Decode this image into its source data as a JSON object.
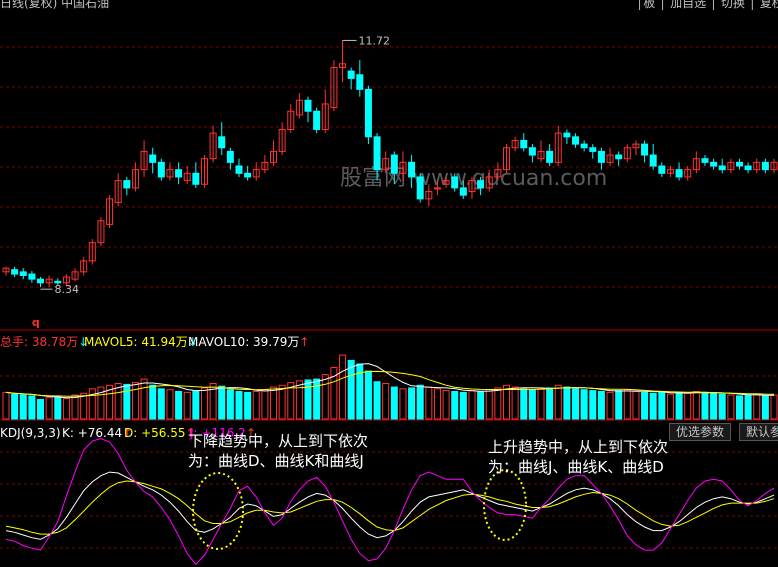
{
  "top_bar": {
    "left_text": "日线(复权) 中国石油",
    "right_text": "│板 │ 加自选 │ 切换 │ 复权 │"
  },
  "price_panel": {
    "high_label": "11.72",
    "low_label": "8.34",
    "marker": "q"
  },
  "watermark": "股富网 www.gucuan.com",
  "volume_header": {
    "total": "总手: 38.78万",
    "mavol5": "MAVOL5: 41.94万",
    "mavol10": "MAVOL10: 39.79万"
  },
  "kdj_header": {
    "name": "KDJ(9,3,3)",
    "k": "K: +76.44",
    "d": "D: +56.55",
    "j": "J: +116.2"
  },
  "buttons": {
    "optimize": "优选参数",
    "default": "默认参"
  },
  "annotations": {
    "down_line1": "下降趋势中，从上到下依次",
    "down_line2": "为：曲线D、曲线K和曲线J",
    "up_line1": "上升趋势中，从上到下依次",
    "up_line2": "为：曲线J、曲线K、曲线D"
  },
  "colors": {
    "up": "#ff3232",
    "down": "#00ffff",
    "grid": "#800000",
    "k_line": "#ffffff",
    "d_line": "#ffff00",
    "j_line": "#ff00ff",
    "mavol5": "#ffffff",
    "mavol10": "#ffff00",
    "ellipse": "#ffff00"
  },
  "chart_data": [
    {
      "type": "candlestick",
      "y_range": [
        8.0,
        12.0
      ],
      "candles": [
        [
          8.55,
          8.6,
          8.5,
          8.62
        ],
        [
          8.58,
          8.52,
          8.48,
          8.62
        ],
        [
          8.55,
          8.5,
          8.45,
          8.6
        ],
        [
          8.52,
          8.45,
          8.4,
          8.56
        ],
        [
          8.45,
          8.4,
          8.34,
          8.48
        ],
        [
          8.4,
          8.45,
          8.34,
          8.5
        ],
        [
          8.42,
          8.4,
          8.36,
          8.46
        ],
        [
          8.4,
          8.48,
          8.36,
          8.52
        ],
        [
          8.45,
          8.55,
          8.42,
          8.6
        ],
        [
          8.55,
          8.7,
          8.5,
          8.75
        ],
        [
          8.7,
          8.95,
          8.65,
          9.0
        ],
        [
          8.95,
          9.25,
          8.9,
          9.3
        ],
        [
          9.2,
          9.55,
          9.15,
          9.6
        ],
        [
          9.5,
          9.8,
          9.45,
          9.9
        ],
        [
          9.8,
          9.7,
          9.6,
          9.85
        ],
        [
          9.7,
          9.95,
          9.65,
          10.05
        ],
        [
          9.95,
          10.2,
          9.85,
          10.35
        ],
        [
          10.15,
          10.05,
          9.9,
          10.25
        ],
        [
          10.05,
          9.85,
          9.8,
          10.1
        ],
        [
          9.85,
          9.95,
          9.8,
          10.05
        ],
        [
          9.95,
          9.85,
          9.75,
          10.05
        ],
        [
          9.8,
          9.9,
          9.75,
          10.0
        ],
        [
          9.9,
          9.75,
          9.7,
          10.05
        ],
        [
          9.75,
          10.1,
          9.7,
          10.15
        ],
        [
          10.1,
          10.45,
          10.05,
          10.55
        ],
        [
          10.4,
          10.25,
          10.15,
          10.6
        ],
        [
          10.2,
          10.05,
          9.95,
          10.25
        ],
        [
          10.0,
          9.9,
          9.85,
          10.1
        ],
        [
          9.9,
          9.85,
          9.8,
          10.0
        ],
        [
          9.85,
          9.95,
          9.8,
          10.05
        ],
        [
          9.95,
          10.05,
          9.9,
          10.15
        ],
        [
          10.05,
          10.2,
          10.0,
          10.35
        ],
        [
          10.2,
          10.5,
          10.15,
          10.6
        ],
        [
          10.5,
          10.75,
          10.45,
          10.85
        ],
        [
          10.7,
          10.9,
          10.65,
          11.0
        ],
        [
          10.9,
          10.75,
          10.6,
          10.95
        ],
        [
          10.75,
          10.5,
          10.45,
          10.8
        ],
        [
          10.5,
          10.85,
          10.45,
          11.05
        ],
        [
          10.8,
          11.35,
          10.75,
          11.45
        ],
        [
          11.35,
          11.4,
          11.15,
          11.72
        ],
        [
          11.3,
          11.2,
          11.05,
          11.35
        ],
        [
          11.25,
          11.05,
          10.95,
          11.45
        ],
        [
          11.05,
          10.4,
          10.3,
          11.1
        ],
        [
          10.4,
          9.95,
          9.8,
          10.45
        ],
        [
          9.95,
          10.1,
          9.9,
          10.2
        ],
        [
          10.15,
          9.9,
          9.75,
          10.2
        ],
        [
          9.9,
          10.05,
          9.8,
          10.2
        ],
        [
          10.05,
          9.85,
          9.7,
          10.15
        ],
        [
          9.85,
          9.55,
          9.5,
          9.9
        ],
        [
          9.55,
          9.65,
          9.45,
          9.75
        ],
        [
          9.7,
          9.7,
          9.6,
          9.8
        ],
        [
          9.75,
          9.8,
          9.7,
          9.85
        ],
        [
          9.85,
          9.7,
          9.65,
          9.9
        ],
        [
          9.7,
          9.6,
          9.55,
          9.8
        ],
        [
          9.65,
          9.8,
          9.55,
          9.85
        ],
        [
          9.8,
          9.7,
          9.6,
          9.85
        ],
        [
          9.7,
          9.85,
          9.65,
          9.95
        ],
        [
          9.85,
          9.95,
          9.8,
          10.05
        ],
        [
          9.95,
          10.25,
          9.9,
          10.3
        ],
        [
          10.25,
          10.35,
          10.2,
          10.4
        ],
        [
          10.35,
          10.25,
          10.2,
          10.45
        ],
        [
          10.25,
          10.15,
          10.05,
          10.3
        ],
        [
          10.1,
          10.2,
          10.05,
          10.35
        ],
        [
          10.2,
          10.05,
          10.0,
          10.3
        ],
        [
          10.05,
          10.45,
          10.0,
          10.55
        ],
        [
          10.45,
          10.4,
          10.3,
          10.5
        ],
        [
          10.4,
          10.3,
          10.25,
          10.45
        ],
        [
          10.3,
          10.25,
          10.2,
          10.35
        ],
        [
          10.25,
          10.2,
          10.1,
          10.3
        ],
        [
          10.2,
          10.05,
          9.95,
          10.25
        ],
        [
          10.05,
          10.15,
          10.0,
          10.25
        ],
        [
          10.15,
          10.1,
          10.0,
          10.2
        ],
        [
          10.1,
          10.25,
          10.05,
          10.3
        ],
        [
          10.25,
          10.3,
          10.15,
          10.35
        ],
        [
          10.3,
          10.15,
          10.05,
          10.35
        ],
        [
          10.15,
          10.0,
          9.95,
          10.3
        ],
        [
          10.0,
          9.9,
          9.85,
          10.05
        ],
        [
          9.9,
          9.95,
          9.85,
          10.0
        ],
        [
          9.95,
          9.85,
          9.8,
          10.05
        ],
        [
          9.85,
          9.95,
          9.8,
          10.0
        ],
        [
          9.95,
          10.1,
          9.9,
          10.2
        ],
        [
          10.1,
          10.05,
          10.0,
          10.15
        ],
        [
          10.05,
          10.0,
          9.95,
          10.1
        ],
        [
          10.0,
          9.95,
          9.9,
          10.1
        ],
        [
          9.95,
          10.05,
          9.9,
          10.1
        ],
        [
          10.05,
          10.0,
          9.95,
          10.1
        ],
        [
          10.0,
          9.95,
          9.9,
          10.05
        ],
        [
          9.95,
          10.05,
          9.9,
          10.1
        ],
        [
          10.05,
          9.95,
          9.9,
          10.1
        ],
        [
          9.95,
          10.05,
          9.9,
          10.1
        ]
      ]
    },
    {
      "type": "bar",
      "title": "总手",
      "values": [
        30,
        28,
        27,
        26,
        22,
        24,
        25,
        23,
        27,
        29,
        34,
        36,
        38,
        40,
        39,
        41,
        45,
        38,
        34,
        33,
        31,
        30,
        32,
        35,
        40,
        37,
        33,
        31,
        30,
        31,
        33,
        36,
        38,
        41,
        43,
        44,
        45,
        50,
        58,
        72,
        66,
        62,
        54,
        42,
        40,
        36,
        34,
        35,
        38,
        36,
        34,
        32,
        31,
        30,
        32,
        31,
        33,
        35,
        38,
        36,
        34,
        33,
        34,
        35,
        38,
        36,
        34,
        33,
        32,
        31,
        30,
        32,
        33,
        31,
        30,
        29,
        30,
        28,
        30,
        29,
        31,
        30,
        29,
        28,
        27,
        26,
        27,
        28,
        26,
        27
      ],
      "up_flags": [
        1,
        0,
        0,
        0,
        0,
        1,
        0,
        1,
        1,
        1,
        1,
        1,
        1,
        1,
        0,
        1,
        1,
        0,
        0,
        1,
        0,
        1,
        0,
        1,
        1,
        0,
        0,
        0,
        0,
        1,
        1,
        1,
        1,
        1,
        1,
        0,
        0,
        1,
        1,
        1,
        0,
        0,
        0,
        0,
        1,
        0,
        1,
        0,
        0,
        1,
        1,
        1,
        0,
        0,
        1,
        0,
        1,
        1,
        1,
        1,
        0,
        0,
        1,
        0,
        1,
        0,
        0,
        0,
        0,
        0,
        1,
        0,
        1,
        1,
        0,
        0,
        0,
        1,
        0,
        1,
        1,
        0,
        0,
        0,
        1,
        0,
        0,
        1,
        0,
        1
      ],
      "ma5_label": "MAVOL5",
      "ma10_label": "MAVOL10"
    },
    {
      "type": "line",
      "title": "KDJ(9,3,3)",
      "y_range": [
        -10,
        130
      ],
      "series": [
        {
          "name": "K",
          "values": [
            30,
            28,
            25,
            22,
            20,
            25,
            32,
            45,
            60,
            75,
            85,
            92,
            96,
            95,
            90,
            85,
            80,
            76,
            70,
            62,
            52,
            40,
            30,
            28,
            32,
            38,
            45,
            55,
            60,
            58,
            52,
            46,
            48,
            55,
            62,
            68,
            72,
            70,
            64,
            55,
            44,
            34,
            26,
            22,
            24,
            30,
            40,
            52,
            62,
            68,
            70,
            72,
            74,
            76,
            72,
            68,
            64,
            60,
            58,
            56,
            54,
            52,
            56,
            60,
            66,
            72,
            76,
            78,
            76,
            72,
            66,
            58,
            48,
            40,
            34,
            30,
            30,
            34,
            40,
            48,
            56,
            62,
            66,
            68,
            66,
            62,
            60,
            62,
            66,
            70
          ]
        },
        {
          "name": "D",
          "values": [
            35,
            33,
            31,
            28,
            26,
            26,
            28,
            33,
            42,
            52,
            62,
            71,
            79,
            84,
            86,
            85,
            83,
            80,
            77,
            72,
            66,
            58,
            49,
            41,
            38,
            38,
            40,
            45,
            50,
            53,
            53,
            51,
            50,
            51,
            55,
            59,
            63,
            65,
            65,
            62,
            56,
            49,
            41,
            34,
            31,
            30,
            33,
            40,
            47,
            54,
            59,
            64,
            67,
            70,
            71,
            70,
            68,
            65,
            63,
            60,
            58,
            56,
            56,
            57,
            60,
            64,
            68,
            71,
            73,
            72,
            70,
            66,
            60,
            53,
            47,
            41,
            37,
            35,
            36,
            40,
            45,
            50,
            55,
            59,
            61,
            61,
            61,
            61,
            63,
            66
          ]
        },
        {
          "name": "J",
          "values": [
            20,
            18,
            13,
            10,
            8,
            23,
            40,
            69,
            96,
            121,
            131,
            134,
            130,
            117,
            98,
            85,
            74,
            68,
            56,
            42,
            24,
            4,
            -8,
            2,
            20,
            38,
            55,
            75,
            80,
            68,
            50,
            36,
            44,
            63,
            76,
            86,
            90,
            80,
            62,
            41,
            20,
            4,
            -4,
            -2,
            10,
            30,
            54,
            76,
            92,
            96,
            92,
            88,
            88,
            88,
            74,
            64,
            56,
            50,
            48,
            48,
            46,
            44,
            56,
            66,
            78,
            88,
            92,
            92,
            82,
            72,
            58,
            42,
            24,
            14,
            8,
            8,
            16,
            32,
            48,
            64,
            78,
            86,
            88,
            86,
            76,
            64,
            58,
            64,
            72,
            78
          ]
        }
      ]
    }
  ]
}
